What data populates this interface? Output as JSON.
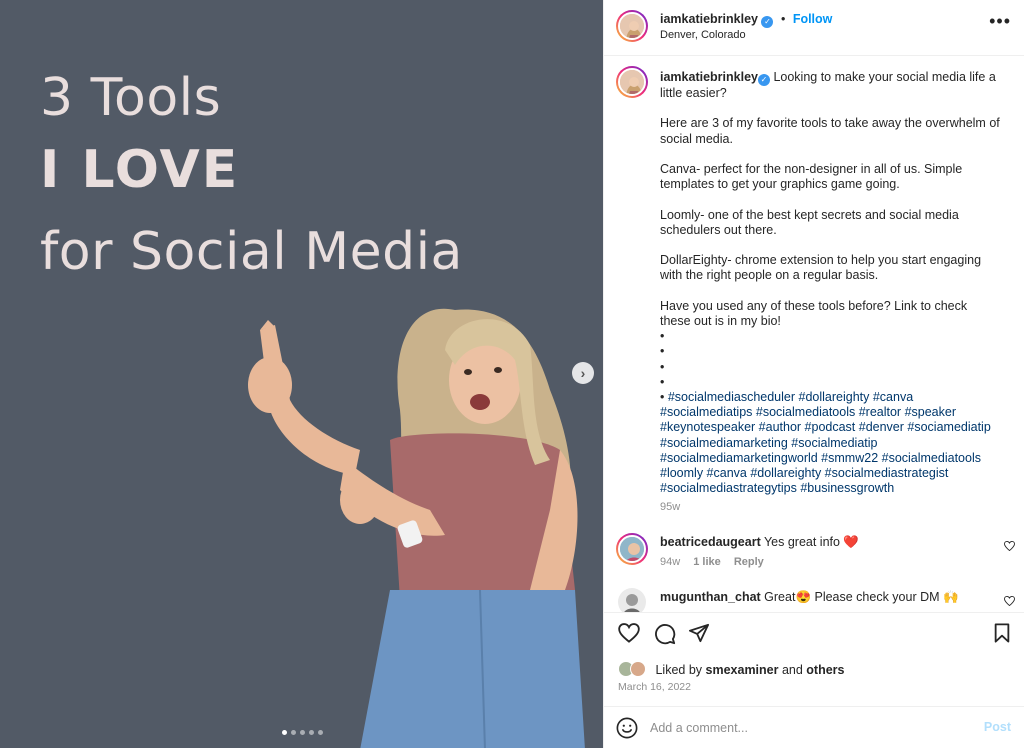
{
  "media": {
    "headline": {
      "line1": "3 Tools",
      "line2": "I LOVE",
      "line3": "for Social Media"
    },
    "background_color": "#525a66",
    "text_color": "#e9dedd",
    "next_icon": "chevron-right-icon",
    "carousel": {
      "total": 5,
      "active": 1
    }
  },
  "header": {
    "username": "iamkatiebrinkley",
    "separator": "•",
    "follow_label": "Follow",
    "location": "Denver, Colorado",
    "more_icon": "more-horizontal-icon"
  },
  "caption": {
    "username": "iamkatiebrinkley",
    "body": " Looking to make your social media life a little easier?\n\nHere are 3 of my favorite tools to take away the overwhelm of social media.\n\nCanva- perfect for the non-designer in all of us. Simple templates to get your graphics game going.\n\nLoomly- one of the best kept secrets and social media schedulers out there.\n\nDollarEighty- chrome extension to help you start engaging with the right people on a regular basis.\n\nHave you used any of these tools before? Link to check these out is in my bio!\n•\n•\n•\n•\n• ",
    "hashtags": "#socialmediascheduler #dollareighty #canva #socialmediatips #socialmediatools #realtor #speaker #keynotespeaker #author #podcast #denver #sociamediatip #socialmediamarketing #socialmediatip #socialmediamarketingworld #smmw22 #socialmediatools #loomly #canva #dollareighty #socialmediastrategist #socialmediastrategytips #businessgrowth",
    "age": "95w"
  },
  "comments": [
    {
      "username": "beatricedaugeart",
      "text": " Yes great info ❤️",
      "age": "94w",
      "likes": "1 like",
      "reply_label": "Reply"
    },
    {
      "username": "mugunthan_chat",
      "text": " Great😍 Please check your DM 🙌",
      "age": "",
      "likes": "",
      "reply_label": ""
    }
  ],
  "actions": {
    "like_icon": "heart-icon",
    "comment_icon": "comment-icon",
    "share_icon": "send-icon",
    "save_icon": "bookmark-icon"
  },
  "likes": {
    "prefix": "Liked by ",
    "user": "smexaminer",
    "middle": " and ",
    "others": "others"
  },
  "date": "March 16, 2022",
  "add_comment": {
    "placeholder": "Add a comment...",
    "post_label": "Post",
    "emoji_icon": "smiley-icon"
  },
  "colors": {
    "accent": "#0095f6",
    "hashtag": "#00376b",
    "muted": "#8e8e8e",
    "post_disabled": "#b2dffc"
  }
}
